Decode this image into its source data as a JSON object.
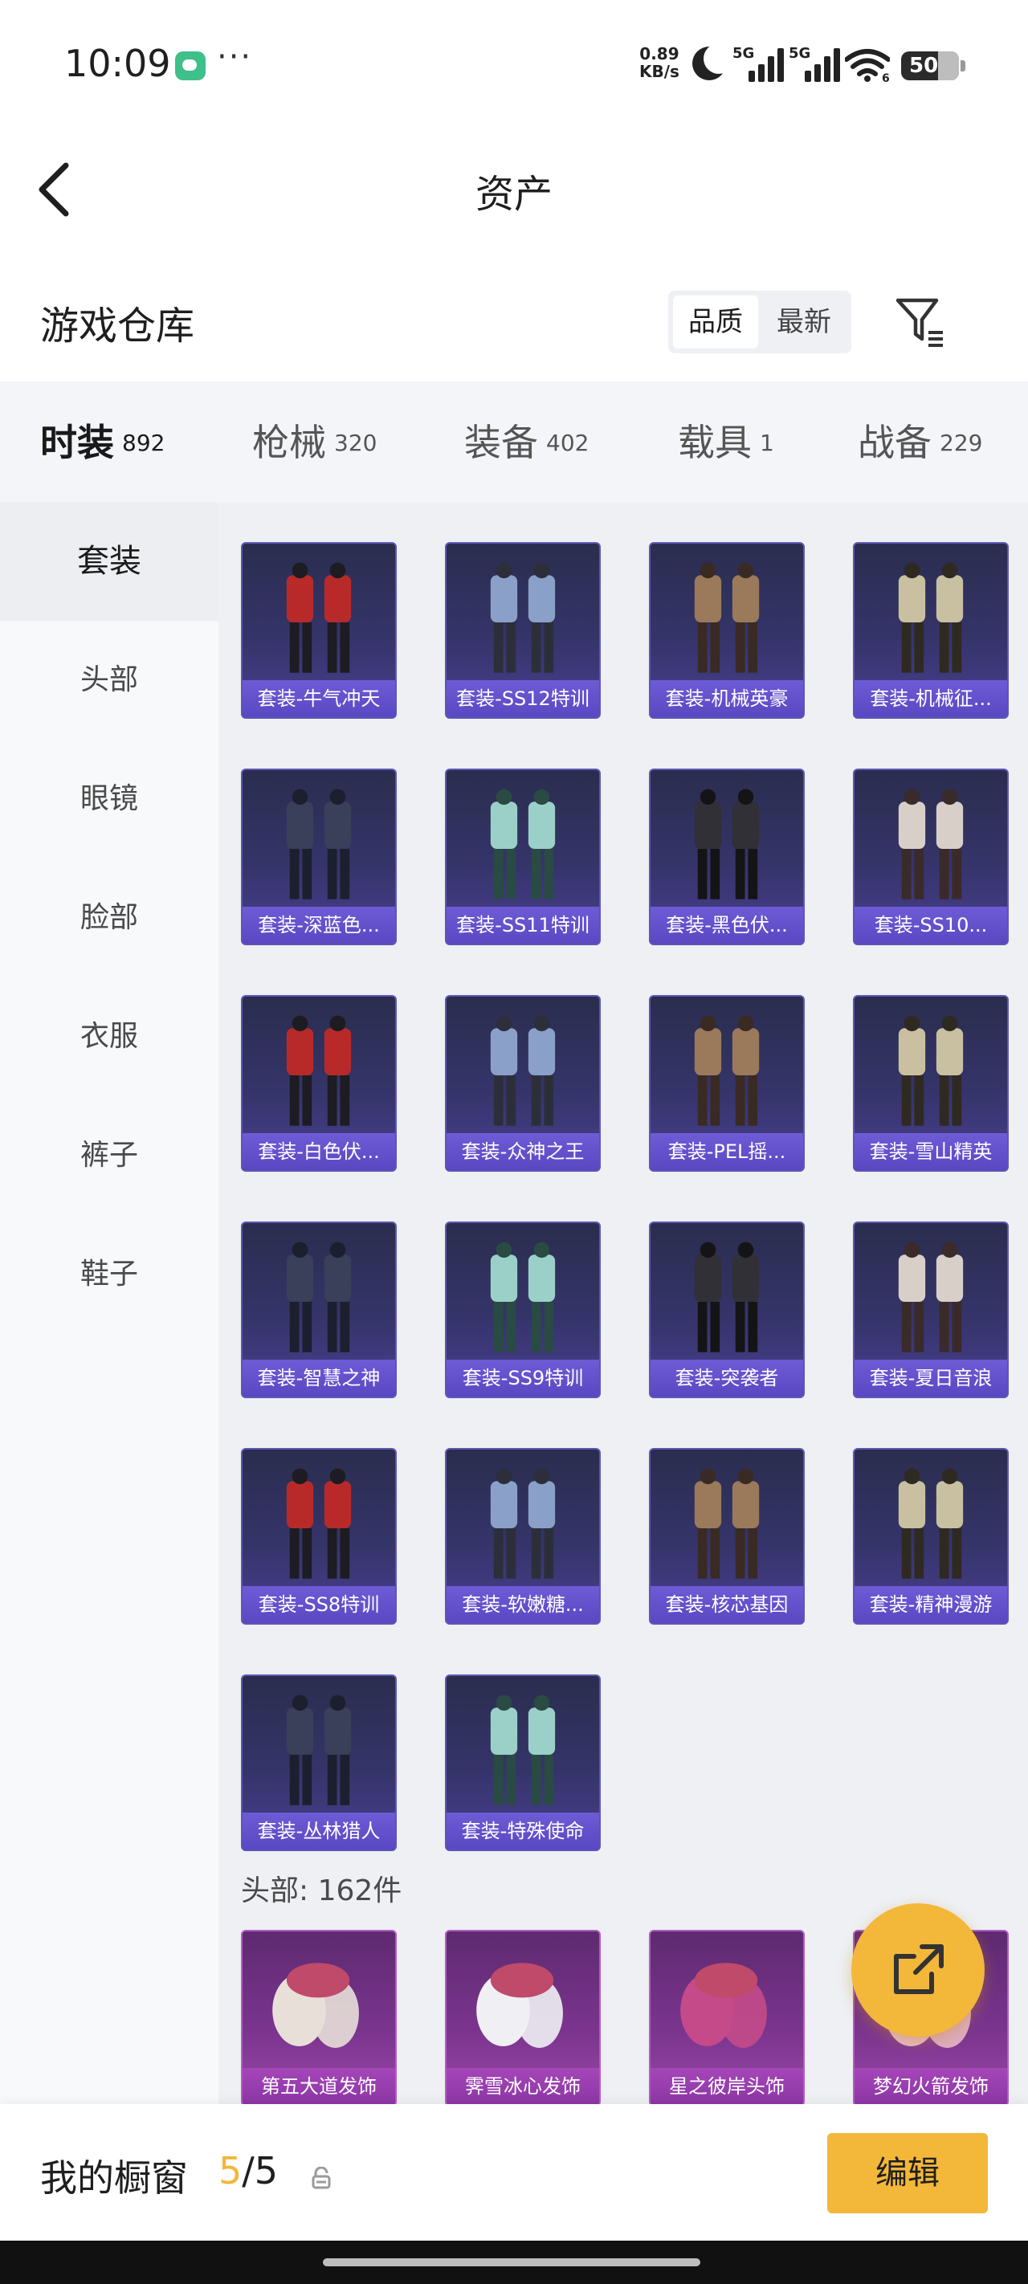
{
  "status_bar": {
    "time": "10:09",
    "dots": "···",
    "net_speed_value": "0.89",
    "net_speed_unit": "KB/s",
    "sim1_label": "5G",
    "sim2_label": "5G",
    "wifi_sub": "6",
    "battery": "50"
  },
  "titlebar": {
    "title": "资产"
  },
  "header": {
    "title": "游戏仓库",
    "sort_options": [
      "品质",
      "最新"
    ],
    "selected_sort": "品质"
  },
  "tabs": [
    {
      "label": "时装",
      "count": "892",
      "active": true
    },
    {
      "label": "枪械",
      "count": "320",
      "active": false
    },
    {
      "label": "装备",
      "count": "402",
      "active": false
    },
    {
      "label": "载具",
      "count": "1",
      "active": false
    },
    {
      "label": "战备",
      "count": "229",
      "active": false
    }
  ],
  "sidebar": {
    "items": [
      "套装",
      "头部",
      "眼镜",
      "脸部",
      "衣服",
      "裤子",
      "鞋子"
    ],
    "active": "套装"
  },
  "suits": [
    "套装-牛气冲天",
    "套装-SS12特训",
    "套装-机械英豪",
    "套装-机械征...",
    "套装-深蓝色...",
    "套装-SS11特训",
    "套装-黑色伏...",
    "套装-SS10...",
    "套装-白色伏...",
    "套装-众神之王",
    "套装-PEL摇...",
    "套装-雪山精英",
    "套装-智慧之神",
    "套装-SS9特训",
    "套装-突袭者",
    "套装-夏日音浪",
    "套装-SS8特训",
    "套装-软嫩糖...",
    "套装-核芯基因",
    "套装-精神漫游",
    "套装-丛林猎人",
    "套装-特殊使命"
  ],
  "head_section": {
    "label": "头部: 162件",
    "items": [
      "第五大道发饰",
      "霁雪冰心发饰",
      "星之彼岸头饰",
      "梦幻火箭发饰"
    ]
  },
  "bottom_bar": {
    "label": "我的橱窗",
    "used": "5",
    "total": "/5",
    "edit_label": "编辑"
  },
  "colors": {
    "accent": "#f3b73a",
    "suit_card": "#35346a",
    "head_card": "#7c3590"
  }
}
